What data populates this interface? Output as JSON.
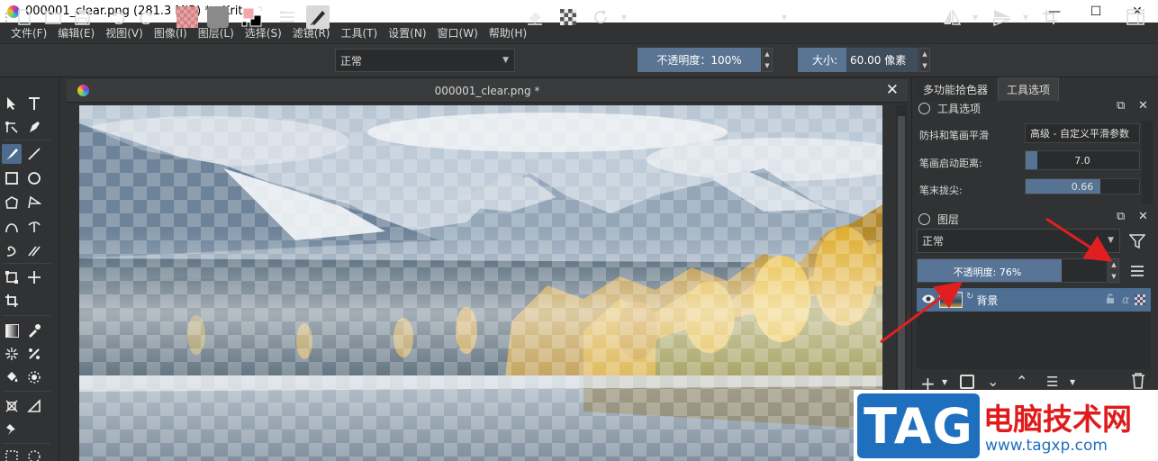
{
  "window": {
    "title": "000001_clear.png (281.3 MiB)  * - Krita",
    "minimize": "—",
    "maximize": "☐",
    "close": "✕"
  },
  "menu": [
    "文件(F)",
    "编辑(E)",
    "视图(V)",
    "图像(I)",
    "图层(L)",
    "选择(S)",
    "滤镜(R)",
    "工具(T)",
    "设置(N)",
    "窗口(W)",
    "帮助(H)"
  ],
  "toolbar": {
    "blend_mode": "正常",
    "opacity_label": "不透明度：100%",
    "opacity_value": 1.0,
    "size_label": "大小:",
    "size_value": "60.00 像素"
  },
  "document": {
    "tab_title": "000001_clear.png *",
    "close": "✕"
  },
  "dock_tabs": [
    "多功能拾色器",
    "工具选项"
  ],
  "tool_options": {
    "header": "工具选项",
    "rows": [
      {
        "label": "防抖和笔画平滑",
        "value": "高级 - 自定义平滑参数"
      },
      {
        "label": "笔画启动距离:",
        "value": "7.0",
        "fill": 0.1
      },
      {
        "label": "笔末拢尖:",
        "value": "0.66",
        "fill": 0.66
      }
    ]
  },
  "layers": {
    "header": "图层",
    "blend_mode": "正常",
    "opacity_label": "不透明度: 76%",
    "opacity_value": 0.76,
    "items": [
      {
        "name": "背景",
        "alpha_symbol": "α"
      }
    ]
  },
  "watermark": {
    "logo": "TAG",
    "name": "电脑技术网",
    "url": "www.tagxp.com"
  },
  "colors": {
    "accent": "#4e6f93",
    "arrow": "#e02020"
  }
}
